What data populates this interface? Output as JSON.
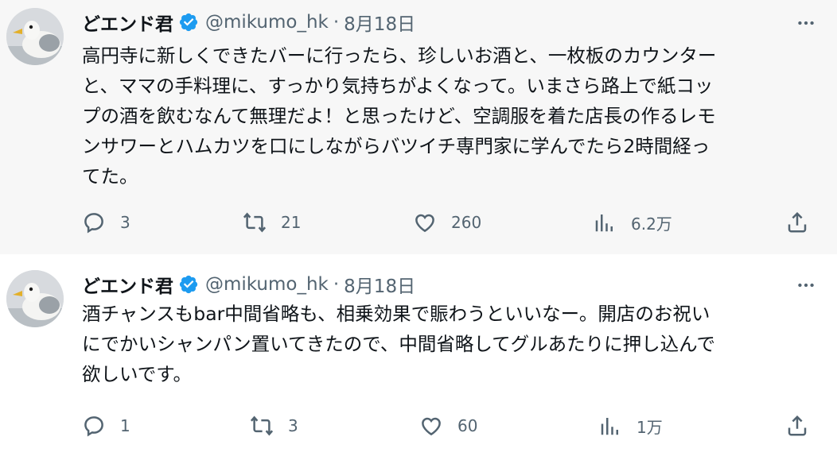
{
  "tweets": [
    {
      "display_name": "どエンド君",
      "handle": "@mikumo_hk",
      "separator": "·",
      "date": "8月18日",
      "text": "高円寺に新しくできたバーに行ったら、珍しいお酒と、一枚板のカウンター\nと、ママの手料理に、すっかり気持ちがよくなって。いまさら路上で紙コッ\nプの酒を飲むなんて無理だよ！と思ったけど、空調服を着た店長の作るレモ\nンサワーとハムカツを口にしながらバツイチ専門家に学んでたら2時間経っ\nてた。",
      "replies": "3",
      "retweets": "21",
      "likes": "260",
      "views": "6.2万"
    },
    {
      "display_name": "どエンド君",
      "handle": "@mikumo_hk",
      "separator": "·",
      "date": "8月18日",
      "text": "酒チャンスもbar中間省略も、相乗効果で賑わうといいなー。開店のお祝い\nにでかいシャンパン置いてきたので、中間省略してグルあたりに押し込んで\n欲しいです。",
      "replies": "1",
      "retweets": "3",
      "likes": "60",
      "views": "1万"
    }
  ],
  "icons": {
    "verified": "verified-badge-icon",
    "more": "more-icon",
    "reply": "reply-icon",
    "retweet": "retweet-icon",
    "like": "like-icon",
    "views": "views-icon",
    "share": "share-icon"
  },
  "colors": {
    "verified_blue": "#1d9bf0",
    "secondary_text": "#536471",
    "primary_text": "#0f1419",
    "thread_line": "#cfd9de",
    "first_tweet_background": "#f7f7f7"
  }
}
